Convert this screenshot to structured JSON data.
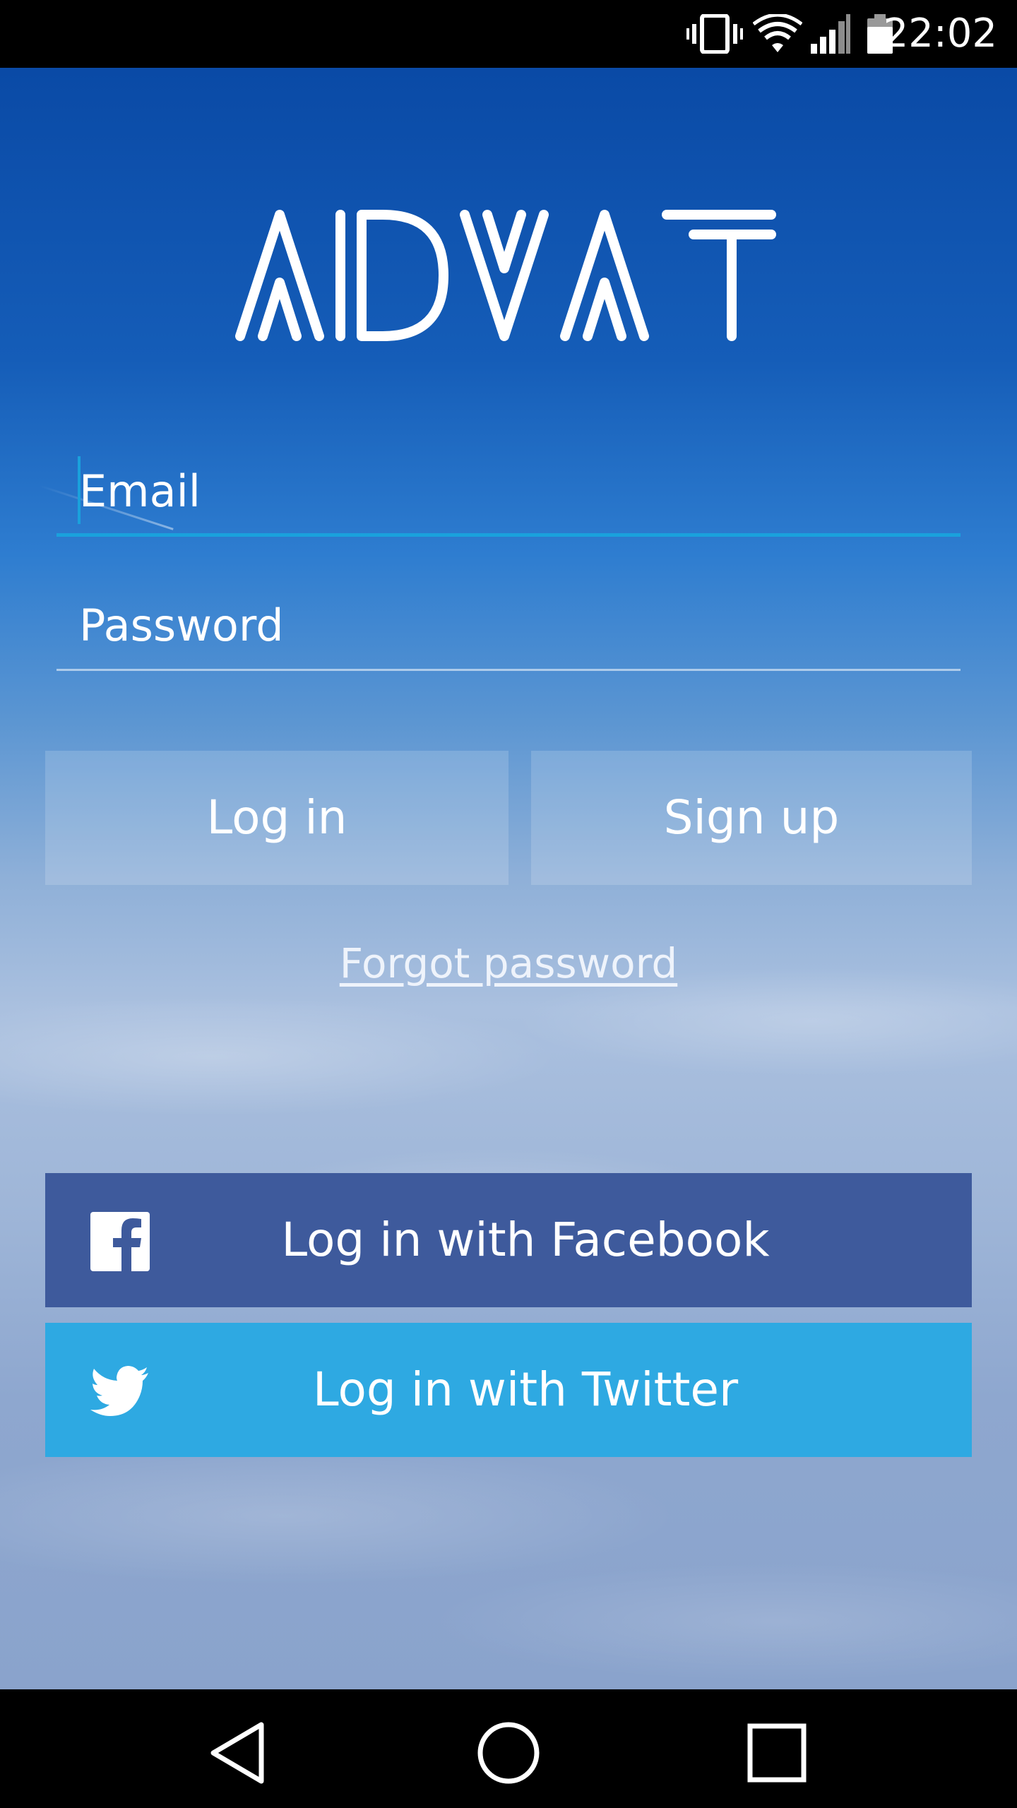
{
  "status_bar": {
    "time": "22:02",
    "icons": [
      "vibrate-icon",
      "wifi-icon",
      "signal-icon",
      "battery-icon"
    ]
  },
  "app": {
    "logo_text": "ADVAT"
  },
  "form": {
    "email_placeholder": "Email",
    "email_value": "",
    "password_placeholder": "Password",
    "password_value": "",
    "focused_field": "email"
  },
  "buttons": {
    "login_label": "Log in",
    "signup_label": "Sign up",
    "forgot_password_label": "Forgot password",
    "facebook_label": "Log in with Facebook",
    "twitter_label": "Log in with Twitter"
  },
  "colors": {
    "facebook": "#3e5a9c",
    "twitter": "#2ea9e2",
    "accent": "#1aa1dc"
  },
  "nav_bar": {
    "icons": [
      "back-icon",
      "home-icon",
      "recents-icon"
    ]
  }
}
